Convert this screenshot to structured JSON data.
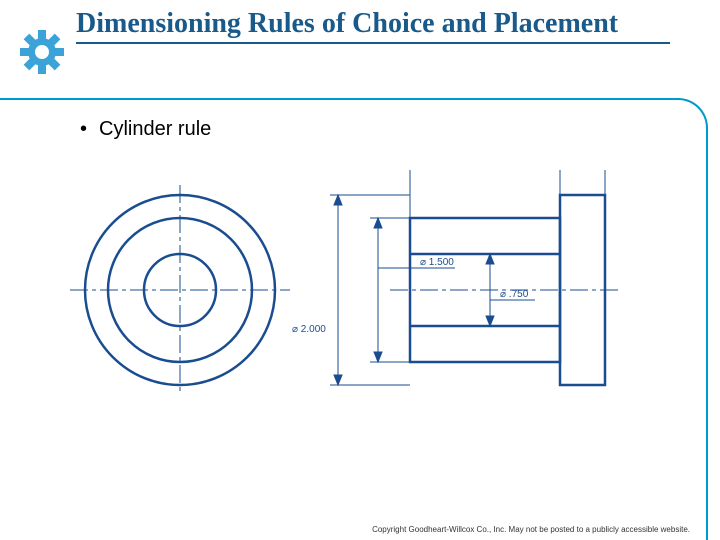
{
  "header": {
    "title": "Dimensioning Rules of Choice and Placement"
  },
  "content": {
    "bullet1": "Cylinder rule"
  },
  "drawing": {
    "dim_outer": "⌀ 2.000",
    "dim_middle": "⌀ 1.500",
    "dim_inner": "⌀ .750"
  },
  "footer": {
    "copyright": "Copyright Goodheart-Willcox Co., Inc. May not be posted to a publicly accessible website."
  }
}
